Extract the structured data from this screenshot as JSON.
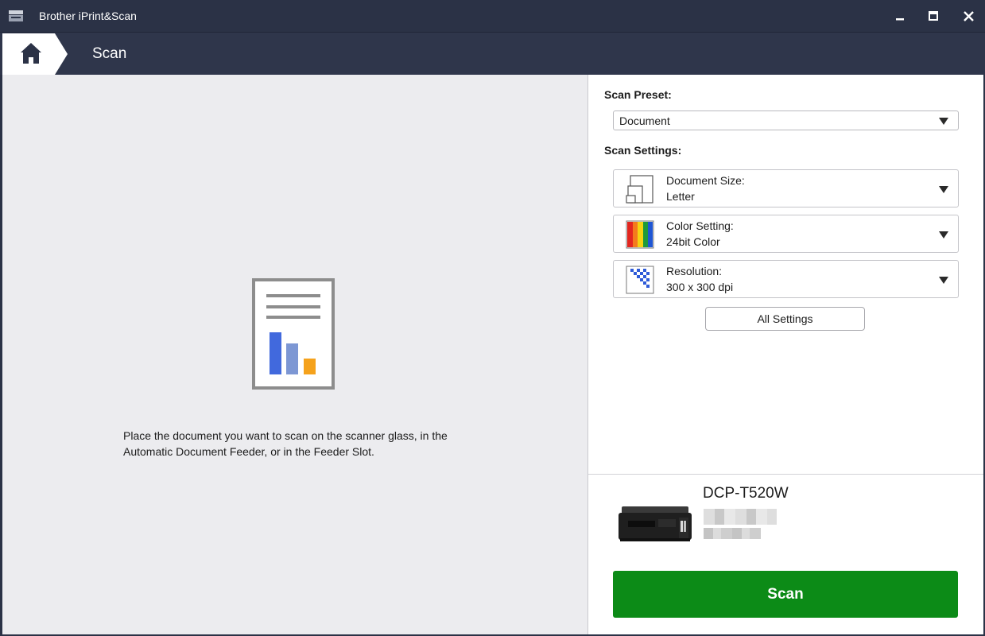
{
  "titlebar": {
    "app_title": "Brother iPrint&Scan",
    "icons": {
      "app": "scanner-app-icon",
      "minimize": "minimize-icon",
      "maximize": "maximize-icon",
      "close": "close-icon"
    }
  },
  "nav": {
    "title": "Scan",
    "home_icon": "home-icon"
  },
  "left": {
    "instruction": "Place the document you want to scan on the scanner glass, in the Automatic Document Feeder, or in the Feeder Slot.",
    "illustration_icon": "document-chart-icon"
  },
  "right": {
    "preset_label": "Scan Preset:",
    "preset_value": "Document",
    "settings_label": "Scan Settings:",
    "settings": [
      {
        "label": "Document Size:",
        "value": "Letter",
        "icon": "document-size-icon"
      },
      {
        "label": "Color Setting:",
        "value": "24bit Color",
        "icon": "color-bars-icon"
      },
      {
        "label": "Resolution:",
        "value": "300 x 300 dpi",
        "icon": "resolution-icon"
      }
    ],
    "all_settings": "All Settings",
    "device": {
      "name": "DCP-T520W",
      "icon": "printer-icon"
    },
    "scan_button": "Scan"
  },
  "colors": {
    "titlebar_bg": "#2b3246",
    "scan_button_green": "#0c8b17",
    "pane_bg": "#ececef"
  }
}
